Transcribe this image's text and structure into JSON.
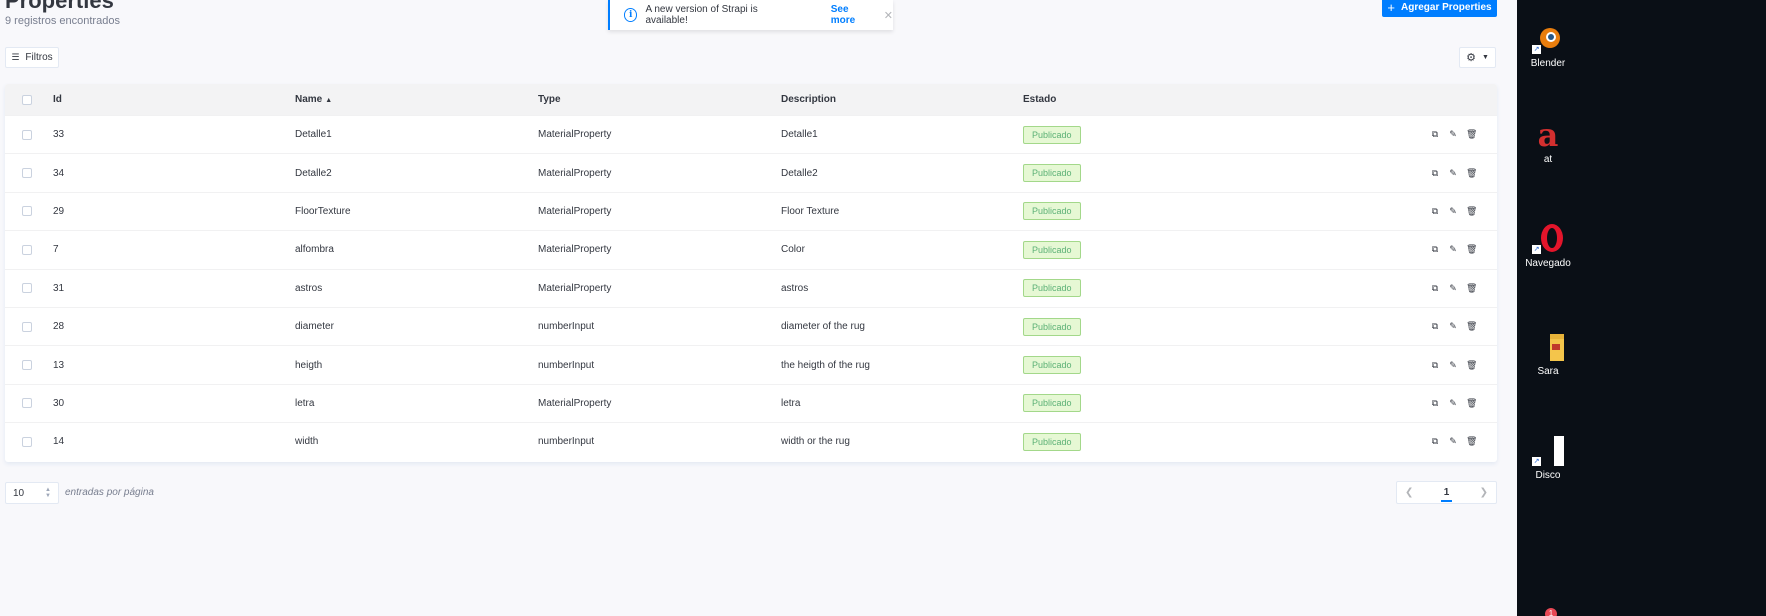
{
  "header": {
    "title": "Properties",
    "subtitle": "9 registros encontrados",
    "add_button_label": "Agregar Properties"
  },
  "notice": {
    "message": "A new version of Strapi is available!",
    "link_label": "See more"
  },
  "toolbar": {
    "filter_label": "Filtros"
  },
  "table": {
    "columns": {
      "id": "Id",
      "name": "Name",
      "type": "Type",
      "description": "Description",
      "state": "Estado"
    },
    "rows": [
      {
        "id": "33",
        "name": "Detalle1",
        "type": "MaterialProperty",
        "description": "Detalle1",
        "state": "Publicado"
      },
      {
        "id": "34",
        "name": "Detalle2",
        "type": "MaterialProperty",
        "description": "Detalle2",
        "state": "Publicado"
      },
      {
        "id": "29",
        "name": "FloorTexture",
        "type": "MaterialProperty",
        "description": "Floor Texture",
        "state": "Publicado"
      },
      {
        "id": "7",
        "name": "alfombra",
        "type": "MaterialProperty",
        "description": "Color",
        "state": "Publicado"
      },
      {
        "id": "31",
        "name": "astros",
        "type": "MaterialProperty",
        "description": "astros",
        "state": "Publicado"
      },
      {
        "id": "28",
        "name": "diameter",
        "type": "numberInput",
        "description": "diameter of the rug",
        "state": "Publicado"
      },
      {
        "id": "13",
        "name": "heigth",
        "type": "numberInput",
        "description": "the heigth of the rug",
        "state": "Publicado"
      },
      {
        "id": "30",
        "name": "letra",
        "type": "MaterialProperty",
        "description": "letra",
        "state": "Publicado"
      },
      {
        "id": "14",
        "name": "width",
        "type": "numberInput",
        "description": "width or the rug",
        "state": "Publicado"
      }
    ]
  },
  "footer": {
    "per_page_value": "10",
    "per_page_label": "entradas por página",
    "current_page": "1"
  },
  "desktop": {
    "icons": [
      {
        "label": "Blender",
        "icon": "blender-icon"
      },
      {
        "label": "at",
        "icon": "app-a-icon"
      },
      {
        "label": "Navegado",
        "icon": "opera-icon"
      },
      {
        "label": "Sara",
        "icon": "folder-icon"
      },
      {
        "label": "Disco",
        "icon": "file-icon"
      }
    ],
    "taskbar_badge": "1"
  },
  "colors": {
    "accent": "#007eff",
    "badge_bg": "#e6f8d4",
    "badge_text": "#5cb176",
    "desktop_bg": "#0a0f16"
  }
}
